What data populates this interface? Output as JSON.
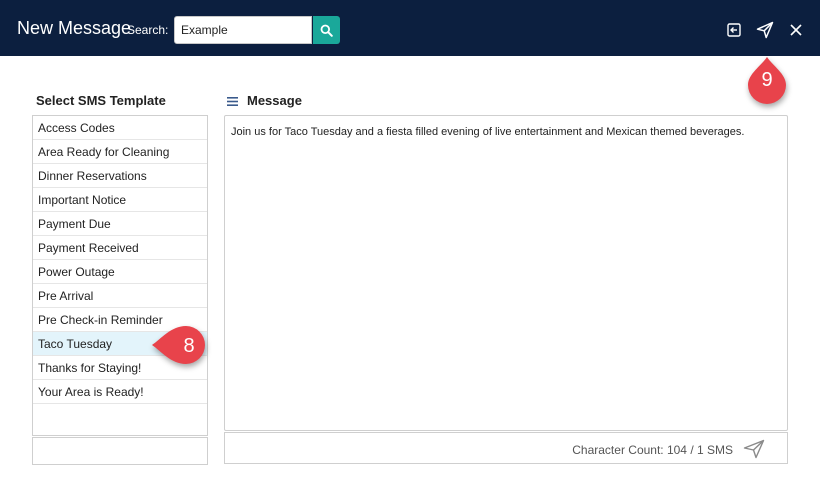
{
  "header": {
    "title": "New Message",
    "search_label": "Search:",
    "search_value": "Example",
    "colors": {
      "background": "#0c1f3f",
      "search_button": "#1aa89a",
      "callout": "#e8434b"
    },
    "icons": [
      "search-icon",
      "sign-out-icon",
      "send-icon",
      "close-icon"
    ]
  },
  "callouts": {
    "send": "9",
    "template": "8"
  },
  "templates": {
    "title": "Select SMS Template",
    "items": [
      "Access Codes",
      "Area Ready for Cleaning",
      "Dinner Reservations",
      "Important Notice",
      "Payment Due",
      "Payment Received",
      "Power Outage",
      "Pre Arrival",
      "Pre Check-in Reminder",
      "Taco Tuesday",
      "Thanks for Staying!",
      "Your Area is Ready!"
    ],
    "selected": "Taco Tuesday"
  },
  "message": {
    "title": "Message",
    "body": "Join us for Taco Tuesday and a fiesta filled evening of live entertainment and Mexican themed beverages.",
    "char_count": "Character Count: 104 / 1 SMS"
  }
}
